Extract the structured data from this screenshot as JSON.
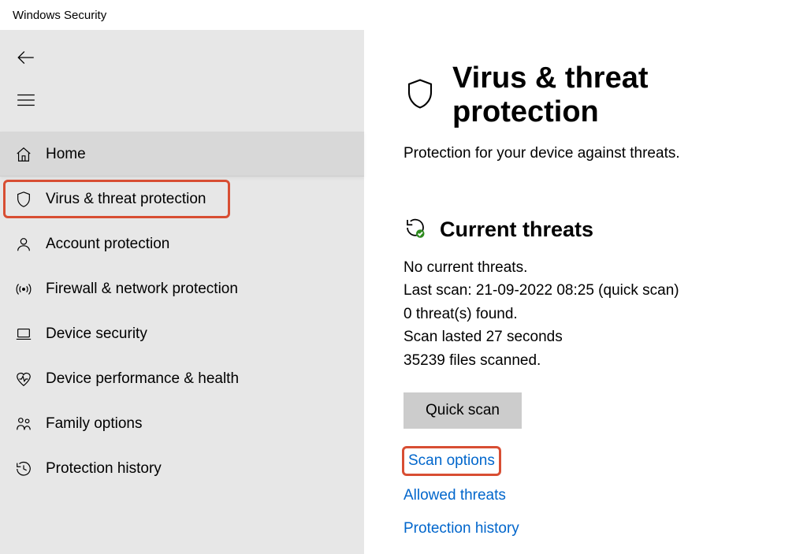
{
  "window": {
    "title": "Windows Security"
  },
  "sidebar": {
    "items": [
      {
        "label": "Home"
      },
      {
        "label": "Virus & threat protection"
      },
      {
        "label": "Account protection"
      },
      {
        "label": "Firewall & network protection"
      },
      {
        "label": "Device security"
      },
      {
        "label": "Device performance & health"
      },
      {
        "label": "Family options"
      },
      {
        "label": "Protection history"
      }
    ]
  },
  "page": {
    "title": "Virus & threat protection",
    "subtitle": "Protection for your device against threats."
  },
  "current_threats": {
    "title": "Current threats",
    "status": "No current threats.",
    "last_scan": "Last scan: 21-09-2022 08:25 (quick scan)",
    "found": "0 threat(s) found.",
    "duration": "Scan lasted 27 seconds",
    "files": "35239 files scanned.",
    "quick_scan_label": "Quick scan",
    "links": {
      "scan_options": "Scan options",
      "allowed_threats": "Allowed threats",
      "protection_history": "Protection history"
    }
  }
}
